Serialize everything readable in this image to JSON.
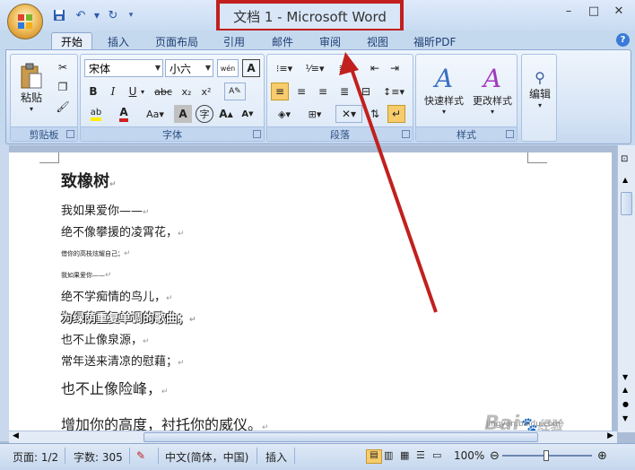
{
  "window": {
    "title": "文档 1 - Microsoft Word"
  },
  "quick_access": {
    "save_icon": "save-icon",
    "undo_icon": "undo-icon",
    "redo_icon": "redo-icon"
  },
  "tabs": [
    {
      "label": "开始",
      "active": true
    },
    {
      "label": "插入"
    },
    {
      "label": "页面布局"
    },
    {
      "label": "引用"
    },
    {
      "label": "邮件"
    },
    {
      "label": "审阅"
    },
    {
      "label": "视图"
    },
    {
      "label": "福昕PDF"
    }
  ],
  "ribbon": {
    "clipboard": {
      "paste": "粘贴",
      "label": "剪贴板"
    },
    "font": {
      "name": "宋体",
      "size": "小六",
      "wen": "wén",
      "label": "字体",
      "font_color": "#d02020",
      "highlight": "#ffee00"
    },
    "paragraph": {
      "label": "段落"
    },
    "styles": {
      "quick": "快速样式",
      "change": "更改样式",
      "label": "样式"
    },
    "editing": {
      "label": "编辑"
    }
  },
  "document": {
    "lines": [
      "致橡树",
      "我如果爱你——",
      "绝不像攀援的凌霄花，",
      "借你的高枝炫耀自己；",
      "我如果爱你——",
      "绝不学痴情的鸟儿，",
      "为绿荫重复单调的歌曲；",
      "也不止像泉源，",
      "常年送来清凉的慰藉；",
      "也不止像险峰，",
      "增加你的高度，衬托你的威仪。"
    ],
    "para_mark": "↵"
  },
  "status": {
    "page": "页面: 1/2",
    "words": "字数: 305",
    "lang": "中文(简体，中国)",
    "mode": "插入",
    "zoom": "100%"
  },
  "watermark": {
    "brand": "Bai",
    "brand2": "经验",
    "url": "jingyan.baidu.com"
  },
  "colors": {
    "annotation": "#c1201e"
  }
}
